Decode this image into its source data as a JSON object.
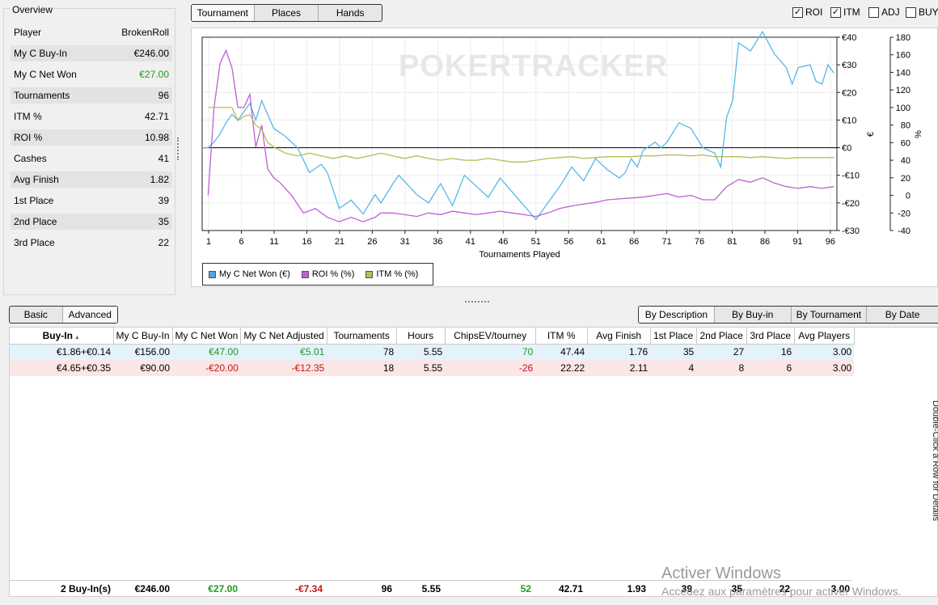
{
  "overview": {
    "title": "Overview",
    "rows": [
      {
        "label": "Player",
        "value": "BrokenRoll"
      },
      {
        "label": "My C Buy-In",
        "value": "€246.00"
      },
      {
        "label": "My C Net Won",
        "value": "€27.00"
      },
      {
        "label": "Tournaments",
        "value": "96"
      },
      {
        "label": "ITM %",
        "value": "42.71"
      },
      {
        "label": "ROI %",
        "value": "10.98"
      },
      {
        "label": "Cashes",
        "value": "41"
      },
      {
        "label": "Avg Finish",
        "value": "1.82"
      },
      {
        "label": "1st Place",
        "value": "39"
      },
      {
        "label": "2nd Place",
        "value": "35"
      },
      {
        "label": "3rd Place",
        "value": "22"
      }
    ]
  },
  "view_tabs": {
    "tournament": "Tournament",
    "places": "Places",
    "hands": "Hands"
  },
  "checkboxes": [
    {
      "label": "ROI",
      "checked": true
    },
    {
      "label": "ITM",
      "checked": true
    },
    {
      "label": "ADJ",
      "checked": false
    },
    {
      "label": "BUY",
      "checked": false
    }
  ],
  "chart_data": {
    "type": "line",
    "xlabel": "Tournaments Played",
    "watermark": "POKERTRACKER",
    "x_ticks": [
      1,
      6,
      11,
      16,
      21,
      26,
      31,
      36,
      41,
      46,
      51,
      56,
      61,
      66,
      71,
      76,
      81,
      86,
      91,
      96
    ],
    "xlim": [
      0,
      97
    ],
    "y_left": {
      "unit": "€",
      "ticks": [
        "€40",
        "€30",
        "€20",
        "€10",
        "€0",
        "-€10",
        "-€20",
        "-€30"
      ],
      "lim": [
        -30,
        40
      ]
    },
    "y_right": {
      "unit": "%",
      "ticks": [
        180,
        160,
        140,
        120,
        100,
        80,
        60,
        40,
        20,
        0,
        -20,
        -40
      ],
      "lim": [
        -40,
        180
      ]
    },
    "series": [
      {
        "name": "My C Net Won (€)",
        "axis": "left",
        "color": "#55b8e8",
        "points": [
          [
            0,
            0
          ],
          [
            1,
            0
          ],
          [
            2,
            2
          ],
          [
            3,
            5
          ],
          [
            4,
            9
          ],
          [
            5,
            12
          ],
          [
            6,
            10
          ],
          [
            7,
            13
          ],
          [
            8,
            16
          ],
          [
            9,
            10
          ],
          [
            10,
            17
          ],
          [
            11,
            12
          ],
          [
            12,
            7
          ],
          [
            14,
            4
          ],
          [
            16,
            0
          ],
          [
            18,
            -9
          ],
          [
            20,
            -6
          ],
          [
            21,
            -9
          ],
          [
            23,
            -22
          ],
          [
            25,
            -19
          ],
          [
            27,
            -24
          ],
          [
            29,
            -17
          ],
          [
            30,
            -20
          ],
          [
            32,
            -13
          ],
          [
            33,
            -10
          ],
          [
            36,
            -17
          ],
          [
            38,
            -20
          ],
          [
            40,
            -13
          ],
          [
            42,
            -21
          ],
          [
            44,
            -10
          ],
          [
            48,
            -18
          ],
          [
            50,
            -11
          ],
          [
            54,
            -21
          ],
          [
            56,
            -26
          ],
          [
            58,
            -20
          ],
          [
            60,
            -14
          ],
          [
            62,
            -7
          ],
          [
            64,
            -12
          ],
          [
            66,
            -4
          ],
          [
            68,
            -8
          ],
          [
            70,
            -11
          ],
          [
            71,
            -9
          ],
          [
            72,
            -4
          ],
          [
            73,
            -7
          ],
          [
            74,
            -1
          ],
          [
            76,
            2
          ],
          [
            77,
            0
          ],
          [
            78,
            2
          ],
          [
            80,
            9
          ],
          [
            82,
            7
          ],
          [
            84,
            0
          ],
          [
            86,
            -2
          ],
          [
            87,
            -7
          ],
          [
            88,
            11
          ],
          [
            89,
            17
          ],
          [
            90,
            38
          ],
          [
            92,
            35
          ],
          [
            94,
            42
          ],
          [
            96,
            34
          ],
          [
            98,
            29
          ],
          [
            99,
            23
          ],
          [
            100,
            29
          ],
          [
            102,
            30
          ],
          [
            103,
            24
          ],
          [
            104,
            23
          ],
          [
            105,
            30
          ],
          [
            106,
            27
          ]
        ]
      },
      {
        "name": "ROI % (%)",
        "axis": "right",
        "color": "#c05ed6",
        "points": [
          [
            1,
            0
          ],
          [
            2,
            100
          ],
          [
            3,
            150
          ],
          [
            4,
            165
          ],
          [
            5,
            145
          ],
          [
            6,
            100
          ],
          [
            7,
            100
          ],
          [
            8,
            115
          ],
          [
            9,
            55
          ],
          [
            10,
            80
          ],
          [
            11,
            30
          ],
          [
            12,
            20
          ],
          [
            13,
            15
          ],
          [
            15,
            0
          ],
          [
            17,
            -20
          ],
          [
            19,
            -15
          ],
          [
            21,
            -25
          ],
          [
            23,
            -30
          ],
          [
            25,
            -25
          ],
          [
            27,
            -30
          ],
          [
            29,
            -25
          ],
          [
            30,
            -20
          ],
          [
            32,
            -20
          ],
          [
            34,
            -22
          ],
          [
            36,
            -24
          ],
          [
            38,
            -20
          ],
          [
            40,
            -22
          ],
          [
            42,
            -18
          ],
          [
            44,
            -20
          ],
          [
            46,
            -22
          ],
          [
            48,
            -20
          ],
          [
            50,
            -18
          ],
          [
            52,
            -20
          ],
          [
            54,
            -22
          ],
          [
            56,
            -24
          ],
          [
            58,
            -20
          ],
          [
            60,
            -15
          ],
          [
            62,
            -12
          ],
          [
            64,
            -10
          ],
          [
            66,
            -8
          ],
          [
            68,
            -5
          ],
          [
            70,
            -4
          ],
          [
            72,
            -3
          ],
          [
            74,
            -2
          ],
          [
            76,
            0
          ],
          [
            78,
            2
          ],
          [
            80,
            -2
          ],
          [
            82,
            0
          ],
          [
            84,
            -5
          ],
          [
            86,
            -5
          ],
          [
            88,
            10
          ],
          [
            90,
            18
          ],
          [
            92,
            15
          ],
          [
            94,
            20
          ],
          [
            96,
            14
          ],
          [
            98,
            10
          ],
          [
            100,
            8
          ],
          [
            102,
            10
          ],
          [
            104,
            8
          ],
          [
            106,
            10
          ]
        ]
      },
      {
        "name": "ITM % (%)",
        "axis": "right",
        "color": "#b8ba56",
        "points": [
          [
            1,
            100
          ],
          [
            2,
            100
          ],
          [
            3,
            100
          ],
          [
            4,
            100
          ],
          [
            5,
            100
          ],
          [
            6,
            85
          ],
          [
            7,
            90
          ],
          [
            8,
            92
          ],
          [
            9,
            80
          ],
          [
            10,
            75
          ],
          [
            11,
            60
          ],
          [
            12,
            55
          ],
          [
            14,
            48
          ],
          [
            16,
            45
          ],
          [
            18,
            48
          ],
          [
            20,
            45
          ],
          [
            22,
            42
          ],
          [
            24,
            45
          ],
          [
            26,
            42
          ],
          [
            28,
            45
          ],
          [
            30,
            48
          ],
          [
            32,
            45
          ],
          [
            34,
            42
          ],
          [
            36,
            45
          ],
          [
            38,
            42
          ],
          [
            40,
            40
          ],
          [
            42,
            42
          ],
          [
            44,
            40
          ],
          [
            46,
            40
          ],
          [
            48,
            42
          ],
          [
            50,
            40
          ],
          [
            52,
            38
          ],
          [
            54,
            38
          ],
          [
            56,
            40
          ],
          [
            58,
            42
          ],
          [
            60,
            43
          ],
          [
            62,
            44
          ],
          [
            64,
            42
          ],
          [
            66,
            43
          ],
          [
            68,
            44
          ],
          [
            70,
            44
          ],
          [
            72,
            44
          ],
          [
            74,
            45
          ],
          [
            76,
            45
          ],
          [
            78,
            46
          ],
          [
            80,
            46
          ],
          [
            82,
            45
          ],
          [
            84,
            46
          ],
          [
            86,
            44
          ],
          [
            88,
            44
          ],
          [
            90,
            44
          ],
          [
            92,
            43
          ],
          [
            94,
            44
          ],
          [
            96,
            43
          ],
          [
            98,
            42
          ],
          [
            100,
            43
          ],
          [
            102,
            43
          ],
          [
            104,
            43
          ],
          [
            106,
            43
          ]
        ]
      }
    ]
  },
  "legend": [
    {
      "label": "My C Net Won (€)",
      "color": "#4fa6df"
    },
    {
      "label": "ROI % (%)",
      "color": "#c05ed6"
    },
    {
      "label": "ITM % (%)",
      "color": "#b8ba56"
    }
  ],
  "mode_tabs": {
    "basic": "Basic",
    "advanced": "Advanced"
  },
  "group_tabs": {
    "by_description": "By Description",
    "by_buyin": "By Buy-in",
    "by_tournament": "By Tournament",
    "by_date": "By Date"
  },
  "table": {
    "columns": [
      "Buy-In",
      "My C Buy-In",
      "My C Net Won",
      "My C Net Adjusted",
      "Tournaments",
      "Hours",
      "ChipsEV/tourney",
      "ITM %",
      "Avg Finish",
      "1st Place",
      "2nd Place",
      "3rd Place",
      "Avg Players"
    ],
    "rows": [
      [
        "€1.86+€0.14",
        "€156.00",
        "€47.00",
        "€5.01",
        "78",
        "5.55",
        "70",
        "47.44",
        "1.76",
        "35",
        "27",
        "16",
        "3.00"
      ],
      [
        "€4.65+€0.35",
        "€90.00",
        "-€20.00",
        "-€12.35",
        "18",
        "5.55",
        "-26",
        "22.22",
        "2.11",
        "4",
        "8",
        "6",
        "3.00"
      ]
    ],
    "totals": [
      "2 Buy-In(s)",
      "€246.00",
      "€27.00",
      "-€7.34",
      "96",
      "5.55",
      "52",
      "42.71",
      "1.93",
      "39",
      "35",
      "22",
      "3.00"
    ],
    "side_hint": "Double-Click a Row for Details"
  },
  "watermark": {
    "line1": "Activer Windows",
    "line2": "Accédez aux paramètres pour activer Windows."
  }
}
